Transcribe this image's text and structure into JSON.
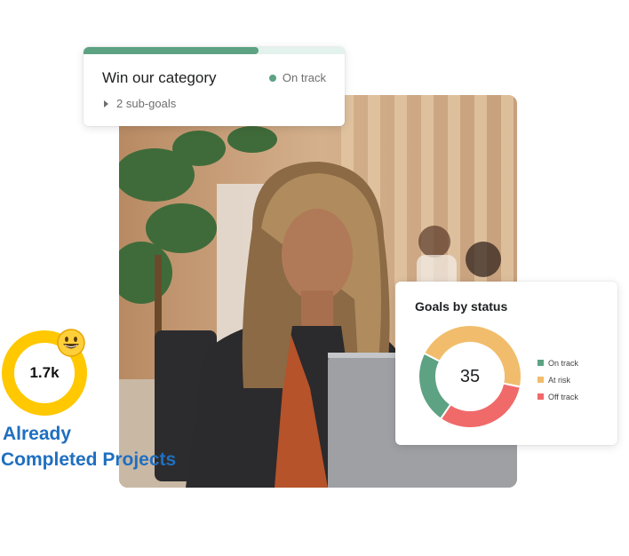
{
  "goal_card": {
    "title": "Win our category",
    "status": "On track",
    "sub_goals": "2 sub-goals",
    "progress_percent": 67
  },
  "status_card": {
    "title": "Goals by status",
    "total": "35"
  },
  "chart_data": {
    "type": "pie",
    "title": "Goals by status",
    "center_label": "35",
    "categories": [
      "On track",
      "At risk",
      "Off track"
    ],
    "values": [
      8,
      16,
      11
    ],
    "colors": [
      "#5da283",
      "#f1bd6c",
      "#f06a6a"
    ],
    "legend_position": "right"
  },
  "badge": {
    "count": "1.7k",
    "caption_line1": "Already",
    "caption_line2": "Completed Projects",
    "ring_color": "#ffc800",
    "caption_color": "#1f6fc0",
    "icon": "smiley-icon"
  },
  "colors": {
    "on_track": "#5da283",
    "at_risk": "#f1bd6c",
    "off_track": "#f06a6a"
  }
}
